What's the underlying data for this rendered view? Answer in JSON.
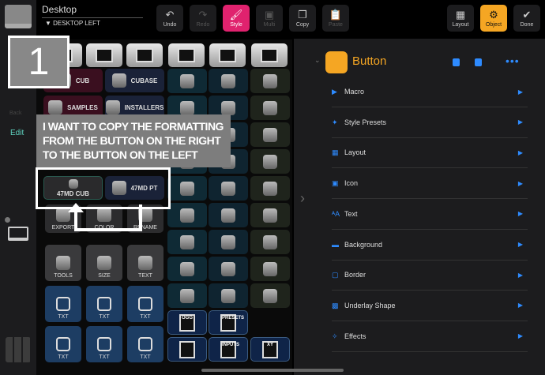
{
  "header": {
    "title": "Desktop",
    "subtitle": "▼ DESKTOP LEFT"
  },
  "toolbar": [
    {
      "label": "Undo",
      "icon": "↶",
      "state": "normal"
    },
    {
      "label": "Redo",
      "icon": "↷",
      "state": "disabled"
    },
    {
      "label": "Style",
      "icon": "🖌",
      "state": "active"
    },
    {
      "label": "Multi",
      "icon": "▣",
      "state": "disabled"
    },
    {
      "label": "Copy",
      "icon": "❐",
      "state": "normal"
    },
    {
      "label": "Paste",
      "icon": "📋",
      "state": "disabled"
    }
  ],
  "right_toolbar": [
    {
      "label": "Layout",
      "icon": "▦"
    },
    {
      "label": "Object",
      "icon": "⚙"
    },
    {
      "label": "Done",
      "icon": "✔"
    }
  ],
  "colors": {
    "style": "#e0226e",
    "object": "#f5a623",
    "accent": "#2e8bff",
    "edit": "#5fd3c0"
  },
  "sidebar": {
    "back": "Back",
    "edit": "Edit"
  },
  "annotation": {
    "number": "1",
    "text": "I WANT TO COPY THE FORMATTING FROM THE BUTTON ON THE RIGHT TO THE BUTTON ON THE LEFT"
  },
  "left_buttons": {
    "row0": [
      "CUB",
      "CUBASE"
    ],
    "row1": [
      "SAMPLES",
      "INSTALLERS"
    ],
    "row4": [
      "47MD CUB",
      "47MD PT"
    ],
    "row5": [
      "EXPORT",
      "COLOR",
      "RENAME"
    ],
    "row6": [
      "TOOLS",
      "SIZE",
      "TEXT"
    ],
    "row7": [
      "TXT",
      "TXT",
      "TXT"
    ],
    "row8": [
      "TXT",
      "TXT",
      "TXT"
    ]
  },
  "icon_labels": [
    "OGG",
    "PRESETS",
    "INPUTS",
    "XY"
  ],
  "panel": {
    "title": "Button",
    "items": [
      "Macro",
      "Style Presets",
      "Layout",
      "Icon",
      "Text",
      "Background",
      "Border",
      "Underlay Shape",
      "Effects"
    ]
  }
}
